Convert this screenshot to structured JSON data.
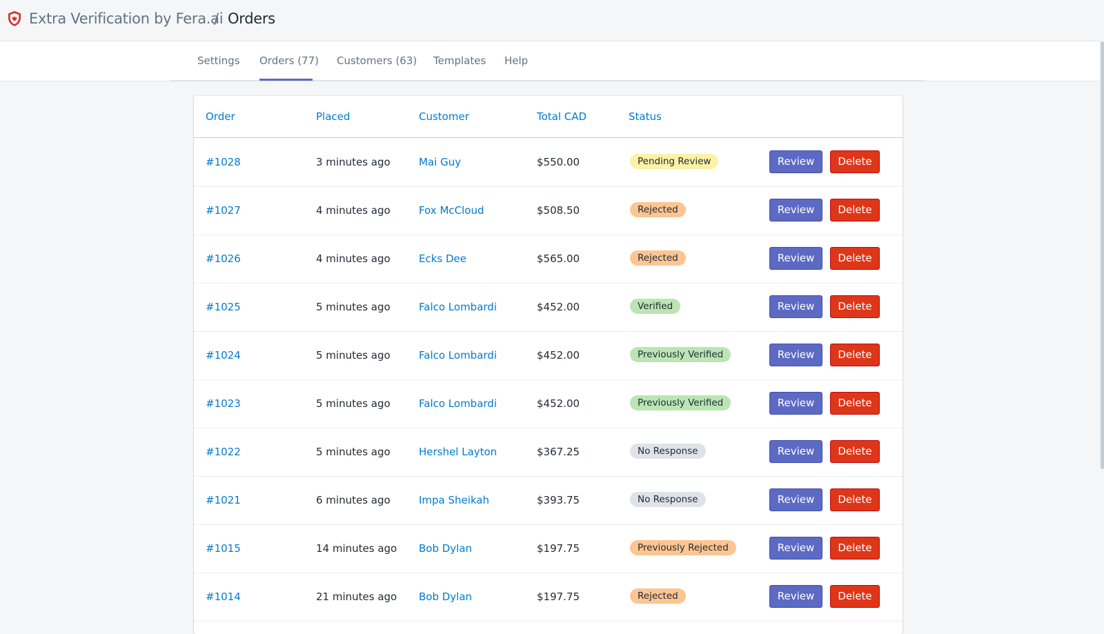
{
  "breadcrumb": {
    "app_name": "Extra Verification by Fera.ai",
    "separator": "/",
    "page": "Orders"
  },
  "nav": {
    "tabs": [
      {
        "label": "Settings",
        "active": false
      },
      {
        "label": "Orders (77)",
        "active": true
      },
      {
        "label": "Customers (63)",
        "active": false
      },
      {
        "label": "Templates",
        "active": false
      },
      {
        "label": "Help",
        "active": false
      }
    ]
  },
  "table": {
    "headers": {
      "order": "Order",
      "placed": "Placed",
      "customer": "Customer",
      "total": "Total CAD",
      "status": "Status"
    },
    "review_label": "Review",
    "delete_label": "Delete",
    "rows": [
      {
        "order": "#1028",
        "placed": "3 minutes ago",
        "customer": "Mai Guy",
        "total": "$550.00",
        "status": "Pending Review",
        "status_type": "pending"
      },
      {
        "order": "#1027",
        "placed": "4 minutes ago",
        "customer": "Fox McCloud",
        "total": "$508.50",
        "status": "Rejected",
        "status_type": "rejected"
      },
      {
        "order": "#1026",
        "placed": "4 minutes ago",
        "customer": "Ecks Dee",
        "total": "$565.00",
        "status": "Rejected",
        "status_type": "rejected"
      },
      {
        "order": "#1025",
        "placed": "5 minutes ago",
        "customer": "Falco Lombardi",
        "total": "$452.00",
        "status": "Verified",
        "status_type": "verified"
      },
      {
        "order": "#1024",
        "placed": "5 minutes ago",
        "customer": "Falco Lombardi",
        "total": "$452.00",
        "status": "Previously Verified",
        "status_type": "verified"
      },
      {
        "order": "#1023",
        "placed": "5 minutes ago",
        "customer": "Falco Lombardi",
        "total": "$452.00",
        "status": "Previously Verified",
        "status_type": "verified"
      },
      {
        "order": "#1022",
        "placed": "5 minutes ago",
        "customer": "Hershel Layton",
        "total": "$367.25",
        "status": "No Response",
        "status_type": "noresp"
      },
      {
        "order": "#1021",
        "placed": "6 minutes ago",
        "customer": "Impa Sheikah",
        "total": "$393.75",
        "status": "No Response",
        "status_type": "noresp"
      },
      {
        "order": "#1015",
        "placed": "14 minutes ago",
        "customer": "Bob Dylan",
        "total": "$197.75",
        "status": "Previously Rejected",
        "status_type": "rejected"
      },
      {
        "order": "#1014",
        "placed": "21 minutes ago",
        "customer": "Bob Dylan",
        "total": "$197.75",
        "status": "Rejected",
        "status_type": "rejected"
      }
    ]
  },
  "colors": {
    "accent": "#5c6ac4",
    "link": "#007ace",
    "danger": "#de3618",
    "status_pending": "#fcf1a7",
    "status_rejected": "#fcc591",
    "status_verified": "#bbe5b3",
    "status_noresp": "#dfe3e8"
  },
  "icons": {
    "logo": "shield-icon"
  }
}
